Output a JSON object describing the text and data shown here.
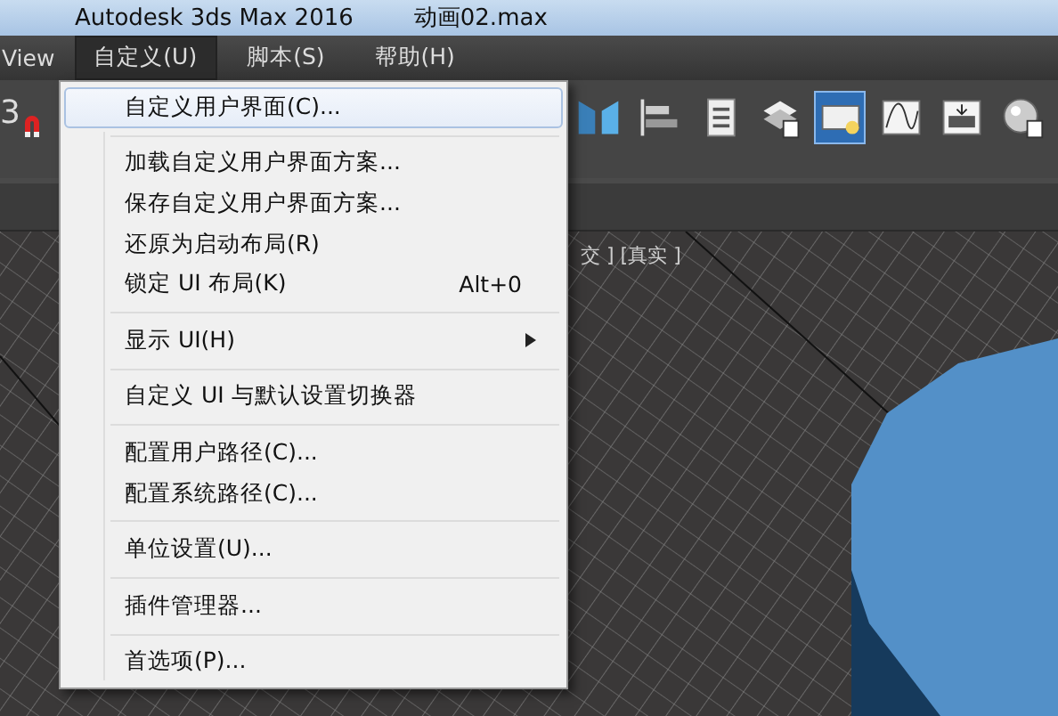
{
  "window": {
    "app_title": "Autodesk 3ds Max 2016",
    "file_name": "动画02.max"
  },
  "menu_bar": [
    {
      "label": "View",
      "selected": false
    },
    {
      "label": "自定义(U)",
      "selected": true
    },
    {
      "label": "脚本(S)",
      "selected": false
    },
    {
      "label": "帮助(H)",
      "selected": false
    }
  ],
  "toolbar": {
    "snap_label": "3",
    "tools": [
      {
        "kind": "mirror",
        "selected": false
      },
      {
        "kind": "align",
        "selected": false
      },
      {
        "kind": "list",
        "selected": false
      },
      {
        "kind": "layers",
        "selected": false
      },
      {
        "kind": "scene",
        "selected": true
      },
      {
        "kind": "curve",
        "selected": false
      },
      {
        "kind": "schematic",
        "selected": false
      },
      {
        "kind": "material",
        "selected": false
      }
    ]
  },
  "dropdown": [
    {
      "kind": "item",
      "label": "自定义用户界面(C)...",
      "selected": true
    },
    {
      "kind": "separator"
    },
    {
      "kind": "item",
      "label": "加载自定义用户界面方案...",
      "selected": false
    },
    {
      "kind": "item",
      "label": "保存自定义用户界面方案...",
      "selected": false
    },
    {
      "kind": "item",
      "label": "还原为启动布局(R)",
      "selected": false
    },
    {
      "kind": "item",
      "label": "锁定 UI 布局(K)",
      "shortcut": "Alt+0",
      "selected": false
    },
    {
      "kind": "separator"
    },
    {
      "kind": "submenu",
      "label": "显示 UI(H)",
      "selected": false
    },
    {
      "kind": "separator"
    },
    {
      "kind": "item",
      "label": "自定义 UI 与默认设置切换器",
      "selected": false
    },
    {
      "kind": "separator"
    },
    {
      "kind": "item",
      "label": "配置用户路径(C)...",
      "selected": false
    },
    {
      "kind": "item",
      "label": "配置系统路径(C)...",
      "selected": false
    },
    {
      "kind": "separator"
    },
    {
      "kind": "item",
      "label": "单位设置(U)...",
      "selected": false
    },
    {
      "kind": "separator"
    },
    {
      "kind": "item",
      "label": "插件管理器...",
      "selected": false
    },
    {
      "kind": "separator"
    },
    {
      "kind": "item",
      "label": "首选项(P)...",
      "selected": false
    }
  ],
  "viewport": {
    "label": "交 ] [真实 ]"
  }
}
